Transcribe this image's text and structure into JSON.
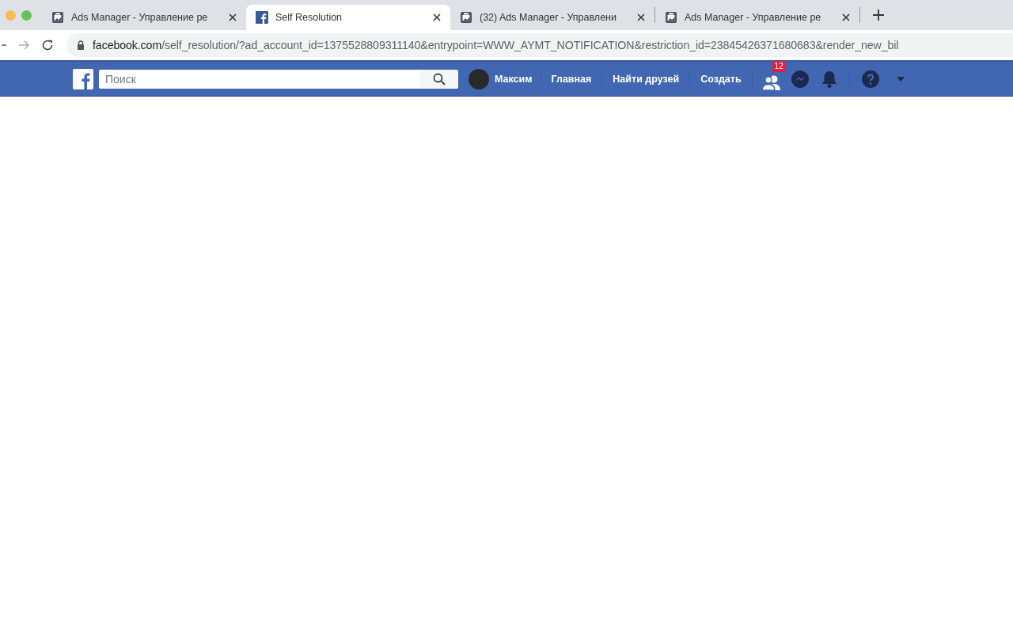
{
  "tabs": [
    {
      "title": "Ads Manager - Управление ре",
      "kind": "ads",
      "selected": false
    },
    {
      "title": "Self Resolution",
      "kind": "facebook",
      "selected": true
    },
    {
      "title": "(32) Ads Manager - Управлени",
      "kind": "ads",
      "selected": false
    },
    {
      "title": "Ads Manager - Управление ре",
      "kind": "ads",
      "selected": false
    }
  ],
  "address_bar": {
    "host": "facebook.com",
    "path": "/self_resolution/?ad_account_id=1375528809311140&entrypoint=WWW_AYMT_NOTIFICATION&restriction_id=23845426371680683&render_new_bil"
  },
  "facebook_bar": {
    "search": {
      "placeholder": "Поиск"
    },
    "profile_name": "Максим",
    "nav": [
      "Главная",
      "Найти друзей",
      "Создать"
    ],
    "friend_requests_badge": "12"
  }
}
